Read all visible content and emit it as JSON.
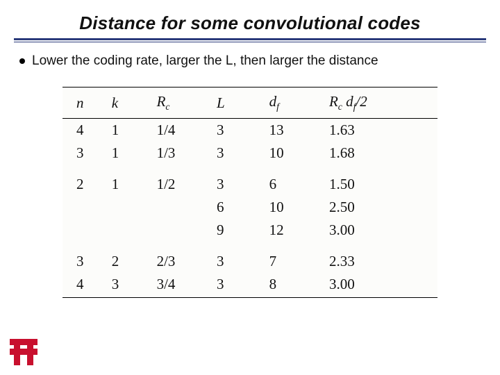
{
  "title": "Distance for some convolutional codes",
  "bullet": "Lower the coding rate, larger the L, then larger the distance",
  "headers": {
    "n": "n",
    "k": "k",
    "Rc_base": "R",
    "Rc_sub": "c",
    "L": "L",
    "df_base": "d",
    "df_sub": "f",
    "last_R": "R",
    "last_c": "c",
    "last_d": " d",
    "last_f": "f",
    "last_tail": "/2"
  },
  "rows": [
    {
      "n": "4",
      "k": "1",
      "Rc": "1/4",
      "L": "3",
      "df": "13",
      "last": "1.63",
      "gap": false
    },
    {
      "n": "3",
      "k": "1",
      "Rc": "1/3",
      "L": "3",
      "df": "10",
      "last": "1.68",
      "gap": false
    },
    {
      "n": "2",
      "k": "1",
      "Rc": "1/2",
      "L": "3",
      "df": "6",
      "last": "1.50",
      "gap": true
    },
    {
      "n": "",
      "k": "",
      "Rc": "",
      "L": "6",
      "df": "10",
      "last": "2.50",
      "gap": false
    },
    {
      "n": "",
      "k": "",
      "Rc": "",
      "L": "9",
      "df": "12",
      "last": "3.00",
      "gap": false
    },
    {
      "n": "3",
      "k": "2",
      "Rc": "2/3",
      "L": "3",
      "df": "7",
      "last": "2.33",
      "gap": true
    },
    {
      "n": "4",
      "k": "3",
      "Rc": "3/4",
      "L": "3",
      "df": "8",
      "last": "3.00",
      "gap": false
    }
  ]
}
